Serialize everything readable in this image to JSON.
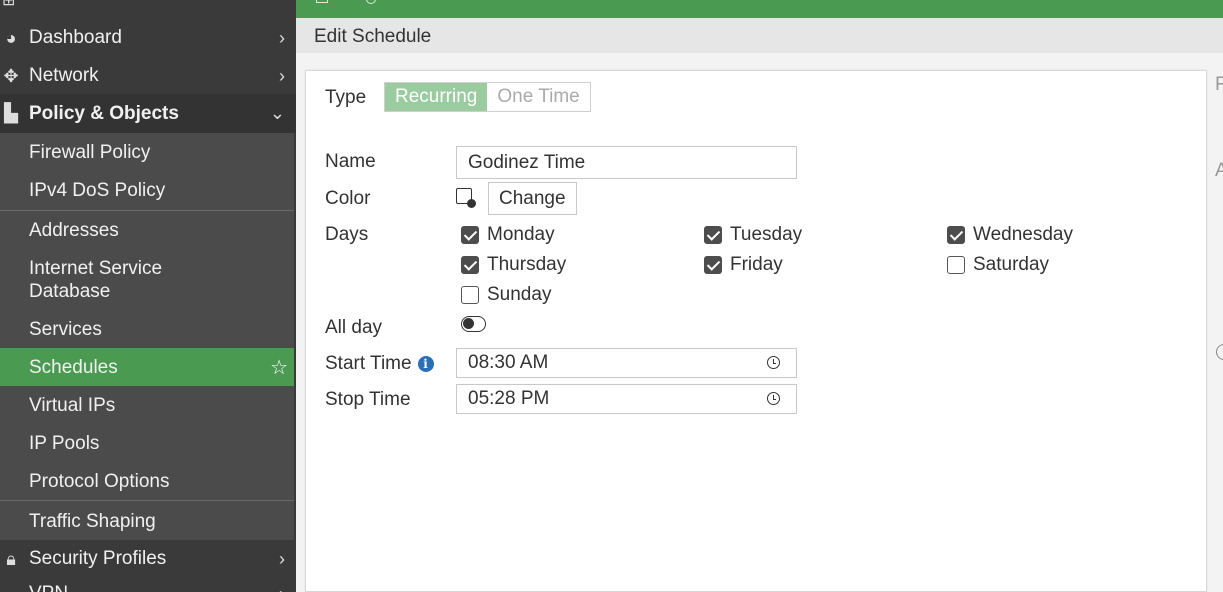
{
  "sidebar": {
    "items": [
      {
        "label": "Dashboard",
        "icon": "dashboard-icon"
      },
      {
        "label": "Network",
        "icon": "network-icon"
      },
      {
        "label": "Policy & Objects",
        "icon": "policy-objects-icon"
      },
      {
        "label": "Security Profiles",
        "icon": "lock-icon"
      },
      {
        "label": "VPN",
        "icon": "vpn-icon"
      }
    ],
    "sub_items": [
      {
        "label": "Firewall Policy"
      },
      {
        "label": "IPv4 DoS Policy"
      },
      {
        "label": "Addresses"
      },
      {
        "label": "Internet Service Database"
      },
      {
        "label": "Services"
      },
      {
        "label": "Schedules"
      },
      {
        "label": "Virtual IPs"
      },
      {
        "label": "IP Pools"
      },
      {
        "label": "Protocol Options"
      },
      {
        "label": "Traffic Shaping"
      }
    ],
    "active_item": "Schedules"
  },
  "header": {
    "title": "Edit Schedule"
  },
  "form": {
    "type_label": "Type",
    "type_options": [
      "Recurring",
      "One Time"
    ],
    "type_selected": "Recurring",
    "name_label": "Name",
    "name_value": "Godinez Time",
    "color_label": "Color",
    "change_button": "Change",
    "days_label": "Days",
    "days": [
      {
        "label": "Monday",
        "checked": true
      },
      {
        "label": "Tuesday",
        "checked": true
      },
      {
        "label": "Wednesday",
        "checked": true
      },
      {
        "label": "Thursday",
        "checked": true
      },
      {
        "label": "Friday",
        "checked": true
      },
      {
        "label": "Saturday",
        "checked": false
      },
      {
        "label": "Sunday",
        "checked": false
      }
    ],
    "all_day_label": "All day",
    "all_day_on": false,
    "start_time_label": "Start Time",
    "start_time_value": "08:30 AM",
    "stop_time_label": "Stop Time",
    "stop_time_value": "05:28 PM"
  },
  "colors": {
    "accent": "#4a9a52",
    "sidebar_bg": "#3a3a3a",
    "segment_on": "#9bcc9f",
    "info": "#2a6fb5"
  }
}
